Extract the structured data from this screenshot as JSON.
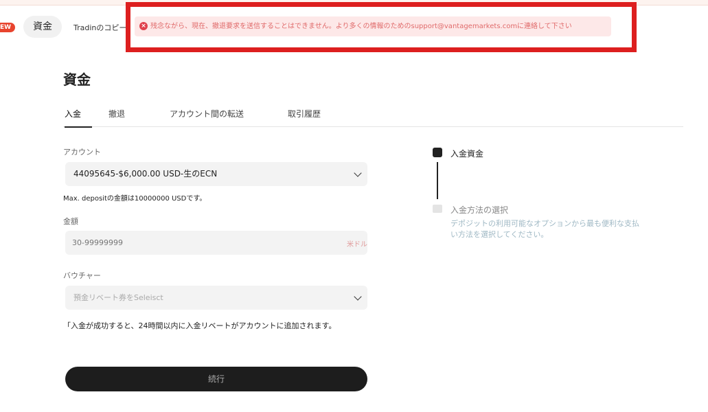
{
  "nav": {
    "new_badge": "EW",
    "funds_pill": "資金",
    "copy_trading": "Tradinのコピー"
  },
  "alert": {
    "message": "残念ながら、現在、撤退要求を送信することはできません。より多くの情報のためのsupport@vantagemarkets.comに連絡して下さい"
  },
  "page": {
    "title": "資金"
  },
  "tabs": [
    {
      "label": "入金"
    },
    {
      "label": "撤退"
    },
    {
      "label": "アカウント間の転送"
    },
    {
      "label": "取引履歴"
    }
  ],
  "form": {
    "account_label": "アカウント",
    "account_value": "44095645-$6,000.00 USD-生のECN",
    "max_deposit_note": "Max. depositの金額は10000000 USDです。",
    "amount_label": "金額",
    "amount_placeholder": "30-99999999",
    "amount_unit": "米ドル",
    "voucher_label": "バウチャー",
    "voucher_placeholder": "預金リベート券をSeleisct",
    "rebate_note": "「入金が成功すると、24時間以内に入金リベートがアカウントに追加されます。",
    "continue_label": "続行"
  },
  "steps": [
    {
      "title": "入金資金"
    },
    {
      "title": "入金方法の選択",
      "description": "デポジットの利用可能なオプションから最も便利な支払い方法を選択してください。"
    }
  ],
  "colors": {
    "alert_border": "#dd1f1f",
    "alert_bg": "#fde8e8",
    "alert_text": "#e06a6a",
    "badge": "#e8442e",
    "button": "#1d1d1d"
  }
}
